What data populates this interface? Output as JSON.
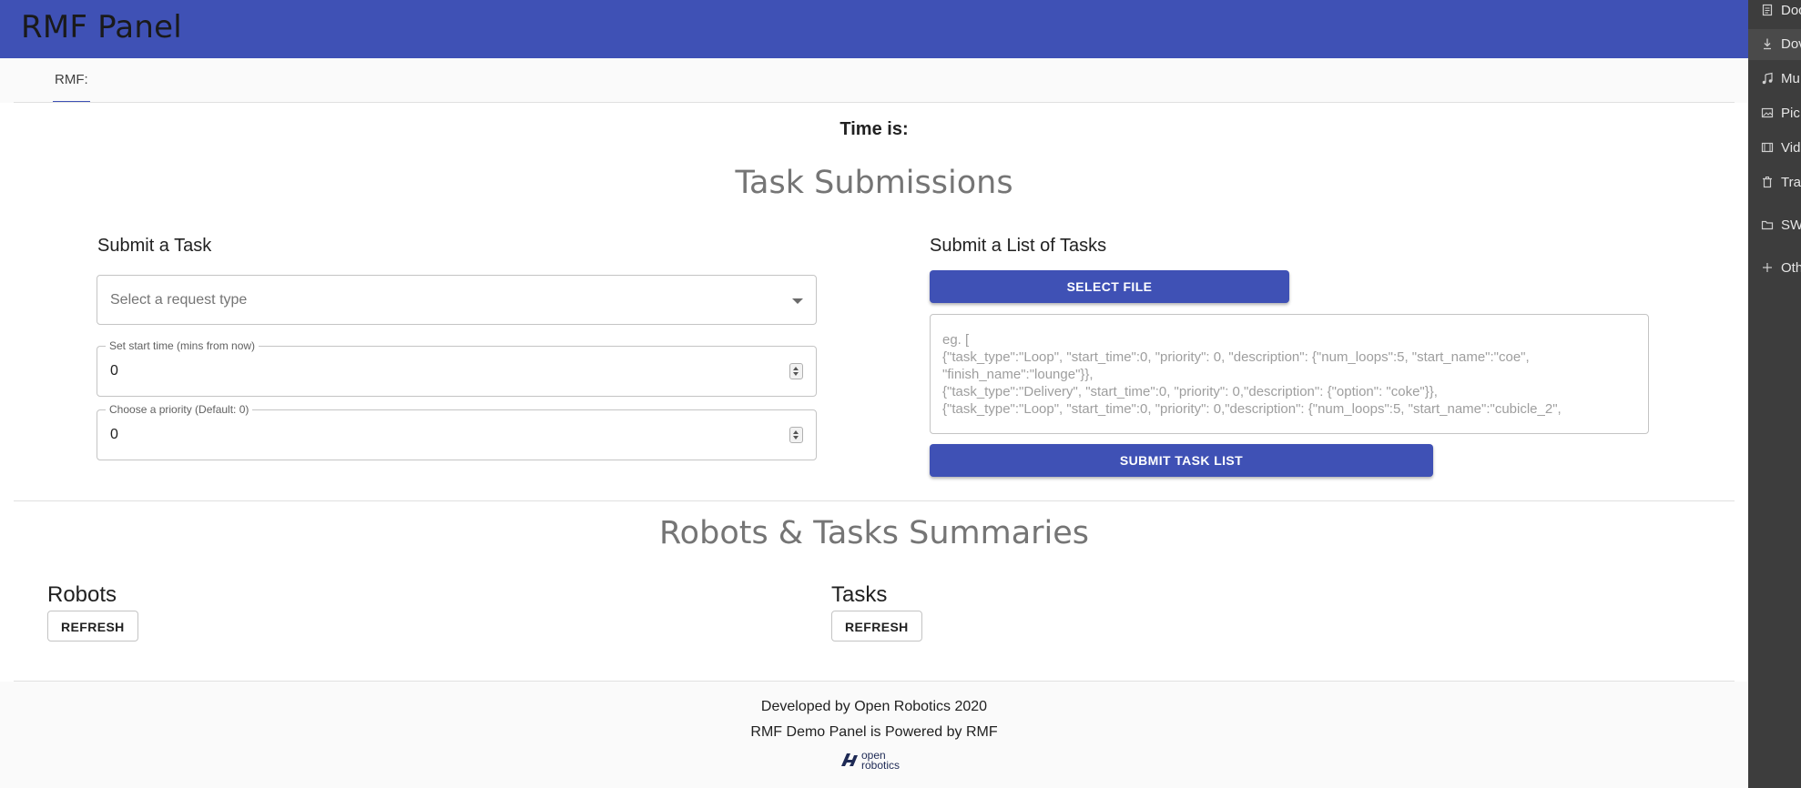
{
  "app": {
    "title": "RMF Panel"
  },
  "tabs": [
    {
      "label": "RMF:"
    }
  ],
  "time": {
    "label": "Time is:"
  },
  "task_submissions": {
    "title": "Task Submissions",
    "single": {
      "heading": "Submit a Task",
      "request_type_placeholder": "Select a request type",
      "start_time": {
        "label": "Set start time (mins from now)",
        "value": "0"
      },
      "priority": {
        "label": "Choose a priority (Default: 0)",
        "value": "0"
      }
    },
    "list": {
      "heading": "Submit a List of Tasks",
      "select_file_label": "SELECT FILE",
      "placeholder_lines": [
        "eg. [",
        "{\"task_type\":\"Loop\", \"start_time\":0, \"priority\": 0, \"description\": {\"num_loops\":5, \"start_name\":\"coe\",",
        "\"finish_name\":\"lounge\"}},",
        "{\"task_type\":\"Delivery\", \"start_time\":0, \"priority\": 0,\"description\": {\"option\": \"coke\"}},",
        "{\"task_type\":\"Loop\", \"start_time\":0, \"priority\": 0,\"description\": {\"num_loops\":5, \"start_name\":\"cubicle_2\","
      ],
      "submit_label": "SUBMIT TASK LIST"
    }
  },
  "summaries": {
    "title": "Robots & Tasks Summaries",
    "robots": {
      "heading": "Robots",
      "refresh_label": "REFRESH"
    },
    "tasks": {
      "heading": "Tasks",
      "refresh_label": "REFRESH"
    }
  },
  "footer": {
    "line1": "Developed by Open Robotics 2020",
    "line2": "RMF Demo Panel is Powered by RMF",
    "logo_word1": "open",
    "logo_word2": "robotics"
  },
  "sidebar": {
    "items": [
      {
        "label": "Doc",
        "icon": "document-icon"
      },
      {
        "label": "Dov",
        "icon": "download-icon"
      },
      {
        "label": "Mu",
        "icon": "music-icon"
      },
      {
        "label": "Pic",
        "icon": "picture-icon"
      },
      {
        "label": "Vid",
        "icon": "video-icon"
      },
      {
        "label": "Tra",
        "icon": "trash-icon"
      },
      {
        "label": "SW",
        "icon": "folder-icon"
      },
      {
        "label": "Oth",
        "icon": "plus-icon"
      }
    ]
  },
  "colors": {
    "primary": "#3f51b5",
    "sidebar_bg": "#3d3d3d"
  }
}
